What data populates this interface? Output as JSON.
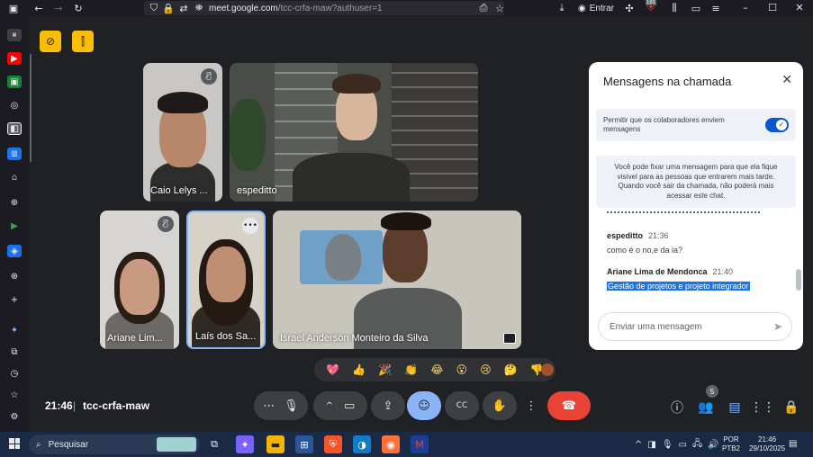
{
  "browser": {
    "url_domain": "meet.google.com",
    "url_path": "/tcc-crfa-maw?authuser=1",
    "signin_label": "Entrar",
    "ext_badge": "181"
  },
  "meeting": {
    "time": "21:46",
    "separator": "|",
    "code": "tcc-crfa-maw"
  },
  "participants": [
    {
      "name": "Caio Lelys ...",
      "muted": true
    },
    {
      "name": "espeditto",
      "muted": false
    },
    {
      "name": "Ariane Lim...",
      "muted": true
    },
    {
      "name": "Laís dos Sa...",
      "muted": false
    },
    {
      "name": "Israel Anderson Monteiro da Silva",
      "muted": false
    }
  ],
  "reactions": [
    "💖",
    "👍",
    "🎉",
    "👏",
    "😂",
    "😮",
    "😢",
    "🤔",
    "👎"
  ],
  "controls": {
    "people_count": "5"
  },
  "chat": {
    "title": "Mensagens na chamada",
    "allow_text": "Permitir que os colaboradores enviem mensagens",
    "pin_info": "Você pode fixar uma mensagem para que ela fique visível para as pessoas que entrarem mais tarde. Quando você sair da chamada, não poderá mais acessar este chat.",
    "messages": [
      {
        "sender": "espeditto",
        "time": "21:36",
        "text": "como é o no,e da ia?"
      },
      {
        "sender": "Ariane Lima de Mendonca",
        "time": "21:40",
        "text": "Gestão de projetos e projeto integrador"
      }
    ],
    "input_placeholder": "Enviar uma mensagem"
  },
  "taskbar": {
    "search_placeholder": "Pesquisar",
    "lang_line1": "POR",
    "lang_line2": "PTB2",
    "clock_time": "21:46",
    "clock_date": "29/10/2025"
  }
}
